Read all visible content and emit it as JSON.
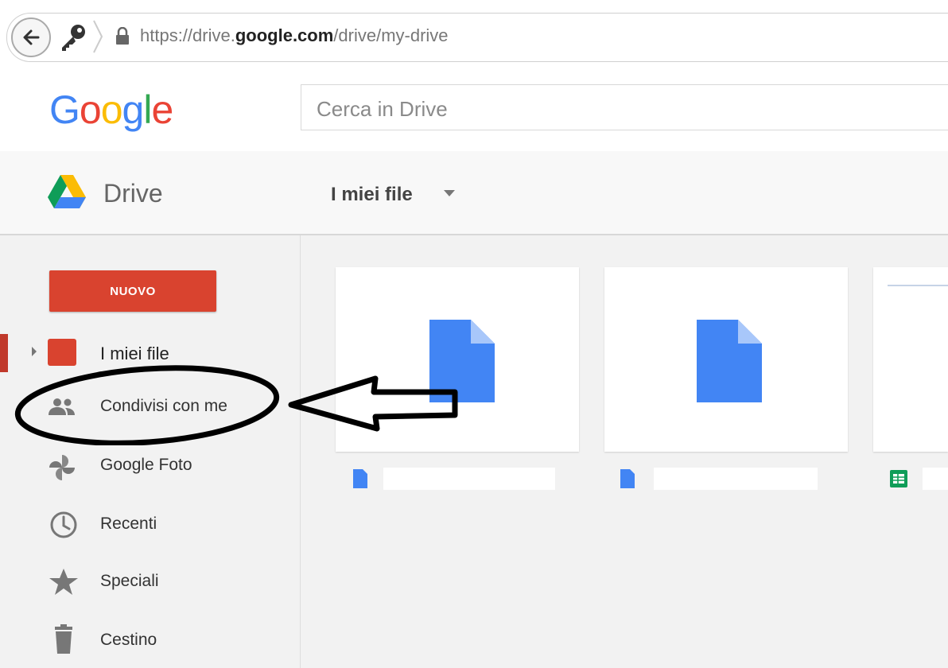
{
  "browser": {
    "url_prefix": "https://drive.",
    "url_domain": "google.com",
    "url_path": "/drive/my-drive",
    "back_icon": "back-arrow-icon",
    "key_icon": "key-icon",
    "lock_icon": "lock-icon"
  },
  "google": {
    "logo_letters": [
      "G",
      "o",
      "o",
      "g",
      "l",
      "e"
    ],
    "logo_colors": [
      "#4285f4",
      "#ea4335",
      "#fbbc05",
      "#4285f4",
      "#34a853",
      "#ea4335"
    ],
    "search_placeholder": "Cerca in Drive"
  },
  "drive_header": {
    "app_name": "Drive",
    "location": "I miei file"
  },
  "sidebar": {
    "new_button": "NUOVO",
    "new_button_color": "#d9432f",
    "items": [
      {
        "label": "I miei file",
        "icon": "my-drive-icon"
      },
      {
        "label": "Condivisi con me",
        "icon": "people-icon"
      },
      {
        "label": "Google Foto",
        "icon": "pinwheel-icon"
      },
      {
        "label": "Recenti",
        "icon": "clock-icon"
      },
      {
        "label": "Speciali",
        "icon": "star-icon"
      },
      {
        "label": "Cestino",
        "icon": "trash-icon"
      }
    ]
  },
  "files": [
    {
      "type": "document",
      "icon": "doc-icon",
      "color": "#4285f4"
    },
    {
      "type": "document",
      "icon": "doc-icon",
      "color": "#4285f4"
    },
    {
      "type": "spreadsheet",
      "icon": "sheet-icon",
      "color": "#0f9d58"
    }
  ]
}
